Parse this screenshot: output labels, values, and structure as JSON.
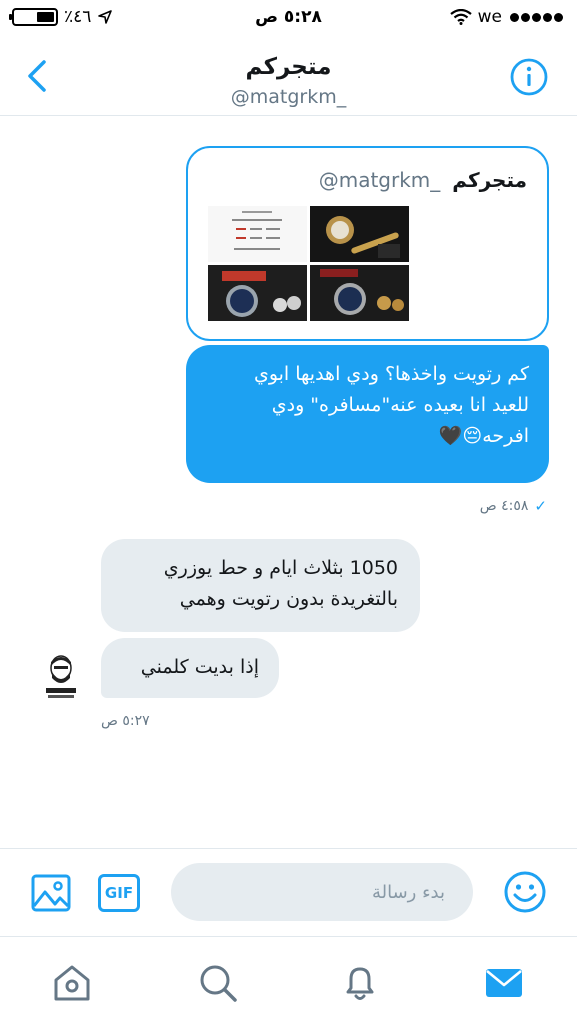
{
  "status_bar": {
    "carrier": "we",
    "time": "٥:٢٨ ص",
    "battery_percent": "٪٤٦",
    "battery_level": 0.46
  },
  "header": {
    "title": "متجركم",
    "handle": "@matgrkm_"
  },
  "shared_tweet": {
    "name": "متجركم",
    "handle": "@matgrkm_"
  },
  "messages": {
    "outgoing": {
      "line1": "كم رتويت واخذها؟ ودي اهديها ابوي",
      "line2": "للعيد انا بعيده عنه\"مسافره\" ودي",
      "line3": "افرحه😔🖤",
      "time": "٤:٥٨ ص",
      "status_icon": "check-icon"
    },
    "incoming1": {
      "line1": "1050 بثلاث ايام و حط يوزري",
      "line2": "بالتغريدة بدون رتويت وهمي"
    },
    "incoming2": {
      "text": "إذا بديت كلمني"
    },
    "incoming_time": "٥:٢٧ ص"
  },
  "composer": {
    "placeholder": "بدء رسالة",
    "gif_label": "GIF"
  },
  "colors": {
    "accent": "#1da1f2",
    "incoming_bubble": "#e6ecf0",
    "text_secondary": "#657786"
  },
  "icons": {
    "tabs": [
      "home-icon",
      "search-icon",
      "notifications-icon",
      "messages-icon"
    ]
  }
}
